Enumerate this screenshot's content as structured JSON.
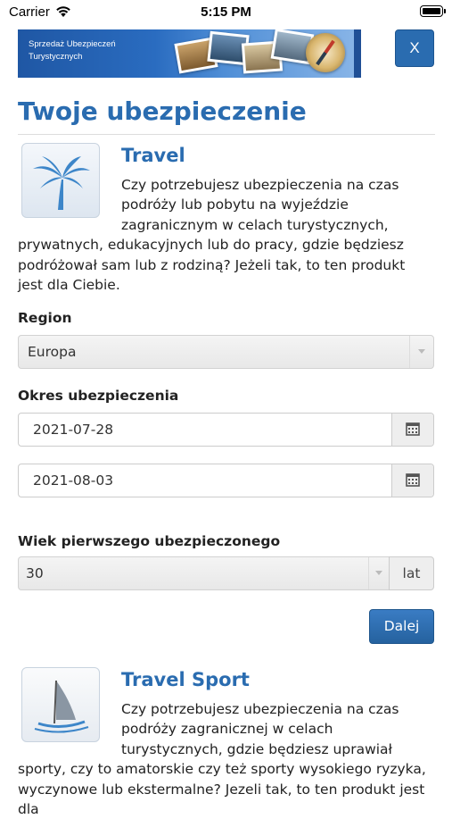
{
  "status_bar": {
    "carrier": "Carrier",
    "time": "5:15 PM"
  },
  "header": {
    "banner_text": "Sprzedaż Ubezpieczeń Turystycznych",
    "close_label": "X"
  },
  "page_title": "Twoje ubezpieczenie",
  "products": [
    {
      "name": "Travel",
      "icon": "palm-tree-icon",
      "description": "Czy potrzebujesz ubezpieczenia na czas podróży lub pobytu na wyjeździe zagranicznym w celach turystycznych, prywatnych, edukacyjnych lub do pracy, gdzie będziesz podróżował sam lub z rodziną? Jeżeli tak, to ten produkt jest dla Ciebie."
    },
    {
      "name": "Travel Sport",
      "icon": "windsurf-icon",
      "description": "Czy potrzebujesz ubezpieczenia na czas podróży zagranicznej w celach turystycznych, gdzie będziesz uprawiał sporty, czy to amatorskie czy też sporty wysokiego ryzyka, wyczynowe lub ekstermalne? Jezeli tak, to ten produkt jest dla"
    }
  ],
  "form": {
    "region_label": "Region",
    "region_value": "Europa",
    "period_label": "Okres ubezpieczenia",
    "date_from": "2021-07-28",
    "date_to": "2021-08-03",
    "age_label": "Wiek pierwszego ubezpieczonego",
    "age_value": "30",
    "age_unit": "lat",
    "next_label": "Dalej"
  },
  "colors": {
    "accent": "#2a6cb0",
    "button": "#2a6cb0"
  }
}
